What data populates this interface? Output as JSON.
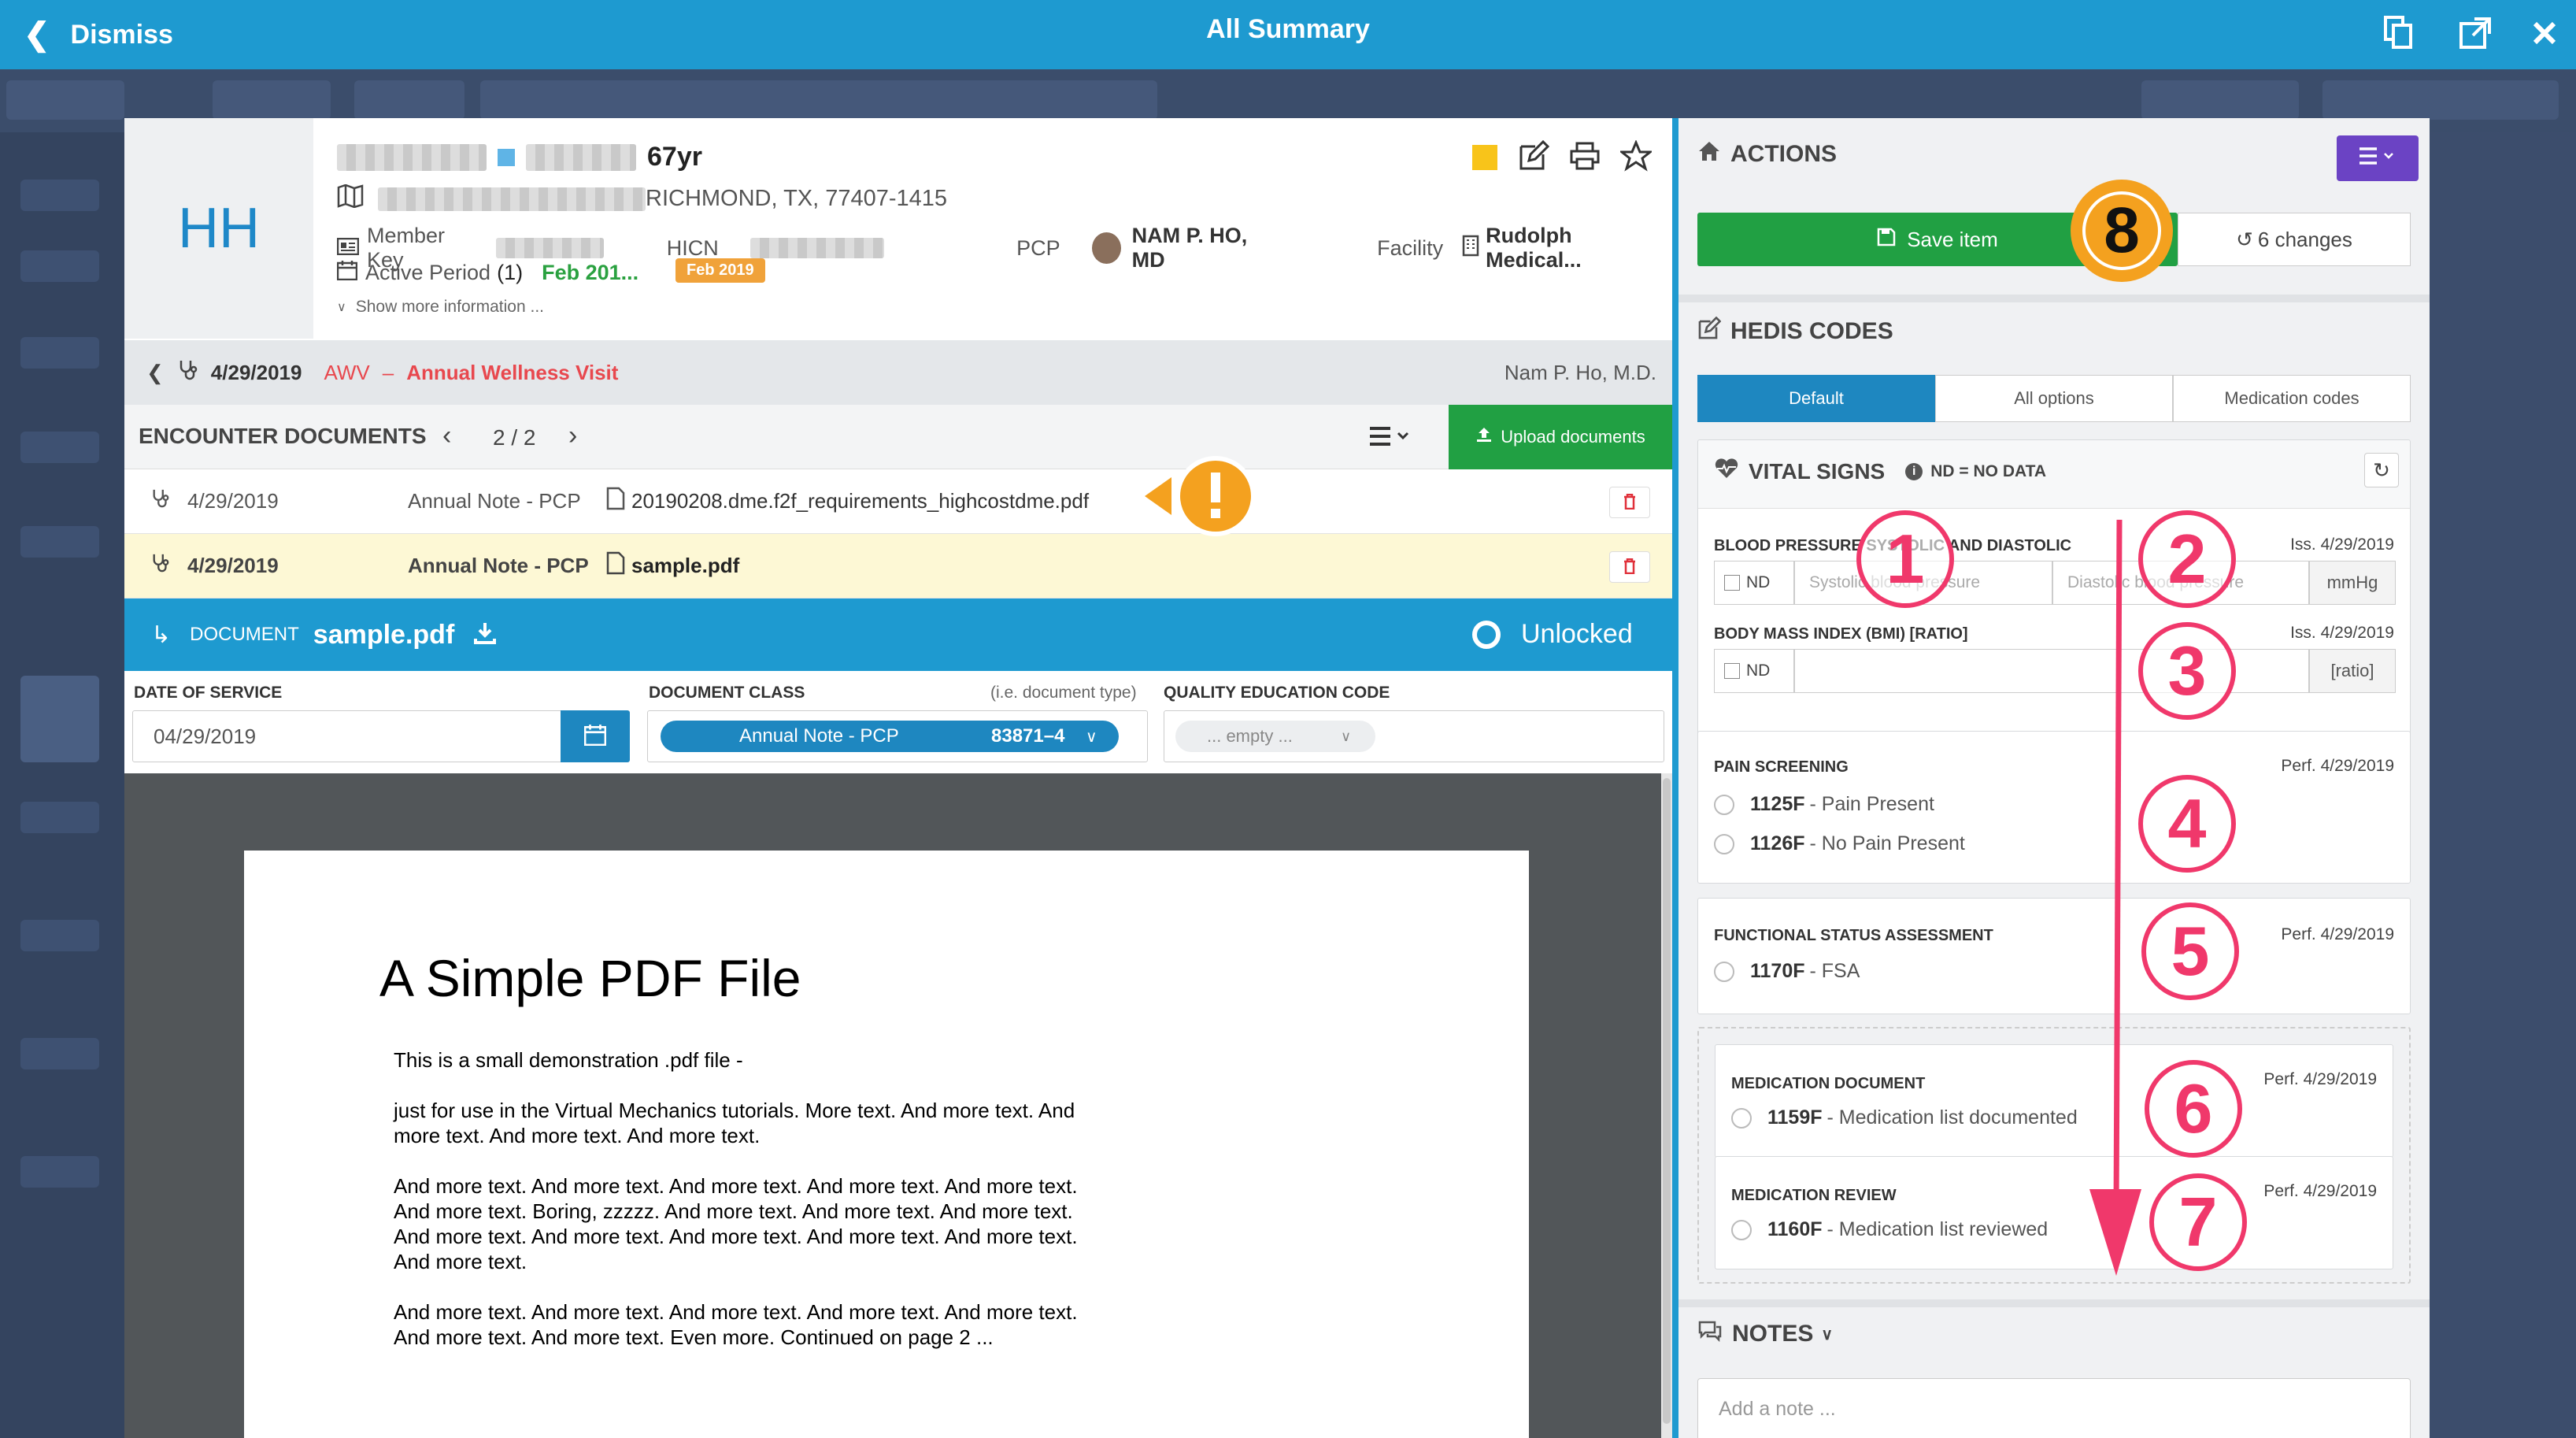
{
  "topbar": {
    "dismiss": "Dismiss",
    "title": "All Summary"
  },
  "patient": {
    "initials": "HH",
    "age": "67yr",
    "address": "RICHMOND, TX, 77407-1415",
    "member_key_label": "Member Key",
    "hicn_label": "HICN",
    "pcp_label": "PCP",
    "pcp_name": "NAM P. HO, MD",
    "facility_label": "Facility",
    "facility_name": "Rudolph Medical...",
    "active_period_label": "Active Period",
    "active_period_count": "(1)",
    "active_period_value": "Feb 201...",
    "period_badge": "Feb 2019",
    "show_more": "Show more information ..."
  },
  "encounter": {
    "date": "4/29/2019",
    "type_code": "AWV",
    "dash": "–",
    "type_name": "Annual Wellness Visit",
    "provider": "Nam P. Ho, M.D."
  },
  "documents": {
    "title": "ENCOUNTER DOCUMENTS",
    "pager": "2 / 2",
    "upload": "Upload documents",
    "rows": [
      {
        "date": "4/29/2019",
        "class": "Annual Note - PCP",
        "file": "20190208.dme.f2f_requirements_highcostdme.pdf"
      },
      {
        "date": "4/29/2019",
        "class": "Annual Note - PCP",
        "file": "sample.pdf"
      }
    ]
  },
  "document": {
    "label": "DOCUMENT",
    "name": "sample.pdf",
    "status": "Unlocked",
    "dos_label": "DATE OF SERVICE",
    "dos_value": "04/29/2019",
    "class_label": "DOCUMENT CLASS",
    "class_hint": "(i.e. document type)",
    "class_value": "Annual Note - PCP",
    "class_code": "83871–4",
    "qec_label": "QUALITY EDUCATION CODE",
    "qec_value": "... empty ..."
  },
  "pdf": {
    "title": "A Simple PDF File",
    "p1": "This is a small demonstration .pdf file -",
    "p2": "just for use in the Virtual Mechanics tutorials. More text. And more text. And more text. And more text. And more text.",
    "p3": "And more text. And more text. And more text. And more text. And more text. And more text. Boring, zzzzz. And more text. And more text. And more text. And more text. And more text. And more text. And more text. And more text. And more text.",
    "p4": "And more text. And more text. And more text. And more text. And more text. And more text. And more text. Even more. Continued on page 2 ..."
  },
  "actions": {
    "title": "ACTIONS",
    "save": "Save item",
    "changes": "6 changes"
  },
  "hedis": {
    "title": "HEDIS CODES",
    "tabs": [
      "Default",
      "All options",
      "Medication codes"
    ]
  },
  "vitals": {
    "title": "VITAL SIGNS",
    "nd_note": "ND = NO DATA",
    "bp_label": "BLOOD PRESSURE SYSTOLIC AND DIASTOLIC",
    "bp_date": "Iss. 4/29/2019",
    "nd": "ND",
    "systolic_placeholder": "Systolic blood pressure",
    "diastolic_placeholder": "Diastolic blood pressure",
    "bp_unit": "mmHg",
    "bmi_label": "BODY MASS INDEX (BMI) [RATIO]",
    "bmi_date": "Iss. 4/29/2019",
    "bmi_unit": "[ratio]"
  },
  "pain": {
    "label": "PAIN SCREENING",
    "date": "Perf. 4/29/2019",
    "opt1_code": "1125F",
    "opt1_text": "- Pain Present",
    "opt2_code": "1126F",
    "opt2_text": "- No Pain Present"
  },
  "functional": {
    "label": "FUNCTIONAL STATUS ASSESSMENT",
    "date": "Perf. 4/29/2019",
    "opt_code": "1170F",
    "opt_text": "- FSA"
  },
  "med_doc": {
    "label": "MEDICATION DOCUMENT",
    "date": "Perf. 4/29/2019",
    "opt_code": "1159F",
    "opt_text": "- Medication list documented"
  },
  "med_review": {
    "label": "MEDICATION REVIEW",
    "date": "Perf. 4/29/2019",
    "opt_code": "1160F",
    "opt_text": "- Medication list reviewed"
  },
  "notes": {
    "title": "NOTES",
    "placeholder": "Add a note ..."
  },
  "annotations": [
    "1",
    "2",
    "3",
    "4",
    "5",
    "6",
    "7",
    "8"
  ],
  "colors": {
    "primary": "#1e9ad0",
    "success": "#21a043",
    "annotation": "#f0386b",
    "highlight": "#f4a11f"
  }
}
